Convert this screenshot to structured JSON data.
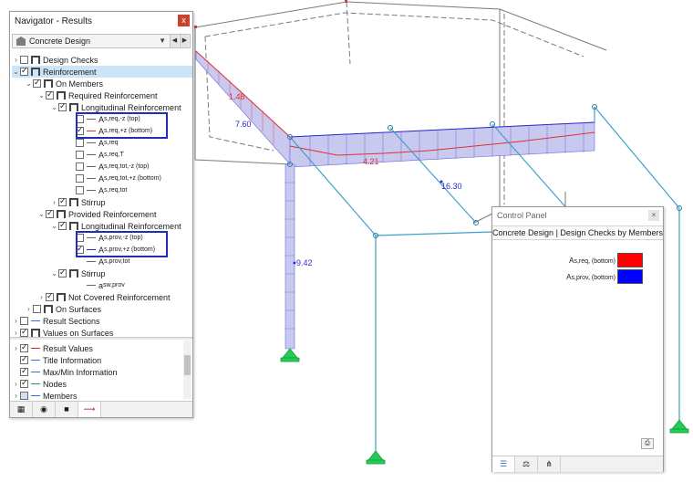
{
  "navigator": {
    "title": "Navigator - Results",
    "close": "x",
    "combo_value": "Concrete Design",
    "tree": {
      "design_checks": "Design Checks",
      "reinforcement": "Reinforcement",
      "on_members": "On Members",
      "required_reinforcement": "Required Reinforcement",
      "longitudinal_reinforcement": "Longitudinal Reinforcement",
      "as_req_z_top": {
        "main": "A",
        "sub": "s,req,-z (top)"
      },
      "as_req_z_bottom": {
        "main": "A",
        "sub": "s,req,+z (bottom)"
      },
      "as_req": {
        "main": "A",
        "sub": "s,req"
      },
      "as_req_t": {
        "main": "A",
        "sub": "s,req,T"
      },
      "as_req_tot_top": {
        "main": "A",
        "sub": "s,req,tot,-z (top)"
      },
      "as_req_tot_bottom": {
        "main": "A",
        "sub": "s,req,tot,+z (bottom)"
      },
      "as_req_tot": {
        "main": "A",
        "sub": "s,req,tot"
      },
      "stirrup": "Stirrup",
      "provided_reinforcement": "Provided Reinforcement",
      "longitudinal_reinforcement_2": "Longitudinal Reinforcement",
      "as_prov_top": {
        "main": "A",
        "sub": "s,prov,-z (top)"
      },
      "as_prov_bottom": {
        "main": "A",
        "sub": "s,prov,+z (bottom)"
      },
      "as_prov_tot": {
        "main": "A",
        "sub": "s,prov,tot"
      },
      "stirrup_2": "Stirrup",
      "asw_prov": {
        "main": "a",
        "sub": "sw,prov"
      },
      "not_covered": "Not Covered Reinforcement",
      "on_surfaces": "On Surfaces",
      "result_sections": "Result Sections",
      "values_on_surfaces": "Values on Surfaces"
    },
    "bottom": {
      "result_values": "Result Values",
      "title_information": "Title Information",
      "max_min_information": "Max/Min Information",
      "nodes": "Nodes",
      "members": "Members"
    }
  },
  "control_panel": {
    "title": "Control Panel",
    "subtitle": "Concrete Design | Design Checks by Members",
    "legend": [
      {
        "main": "A",
        "sub": "s,req, (bottom)",
        "color": "#ff0000"
      },
      {
        "main": "A",
        "sub": "s,prov, (bottom)",
        "color": "#0000ff"
      }
    ]
  },
  "model_labels": {
    "v1": "1.48",
    "v2": "7.60",
    "v3": "4.21",
    "v4": "16.30",
    "v5": "9.42"
  },
  "colors": {
    "member_line": "#3fa0c8",
    "fill": "#c9c8ef",
    "req_line": "#e03030",
    "prov_line": "#2a2acd",
    "support": "#22cc55",
    "highlight_box": "#1f2dbf"
  }
}
